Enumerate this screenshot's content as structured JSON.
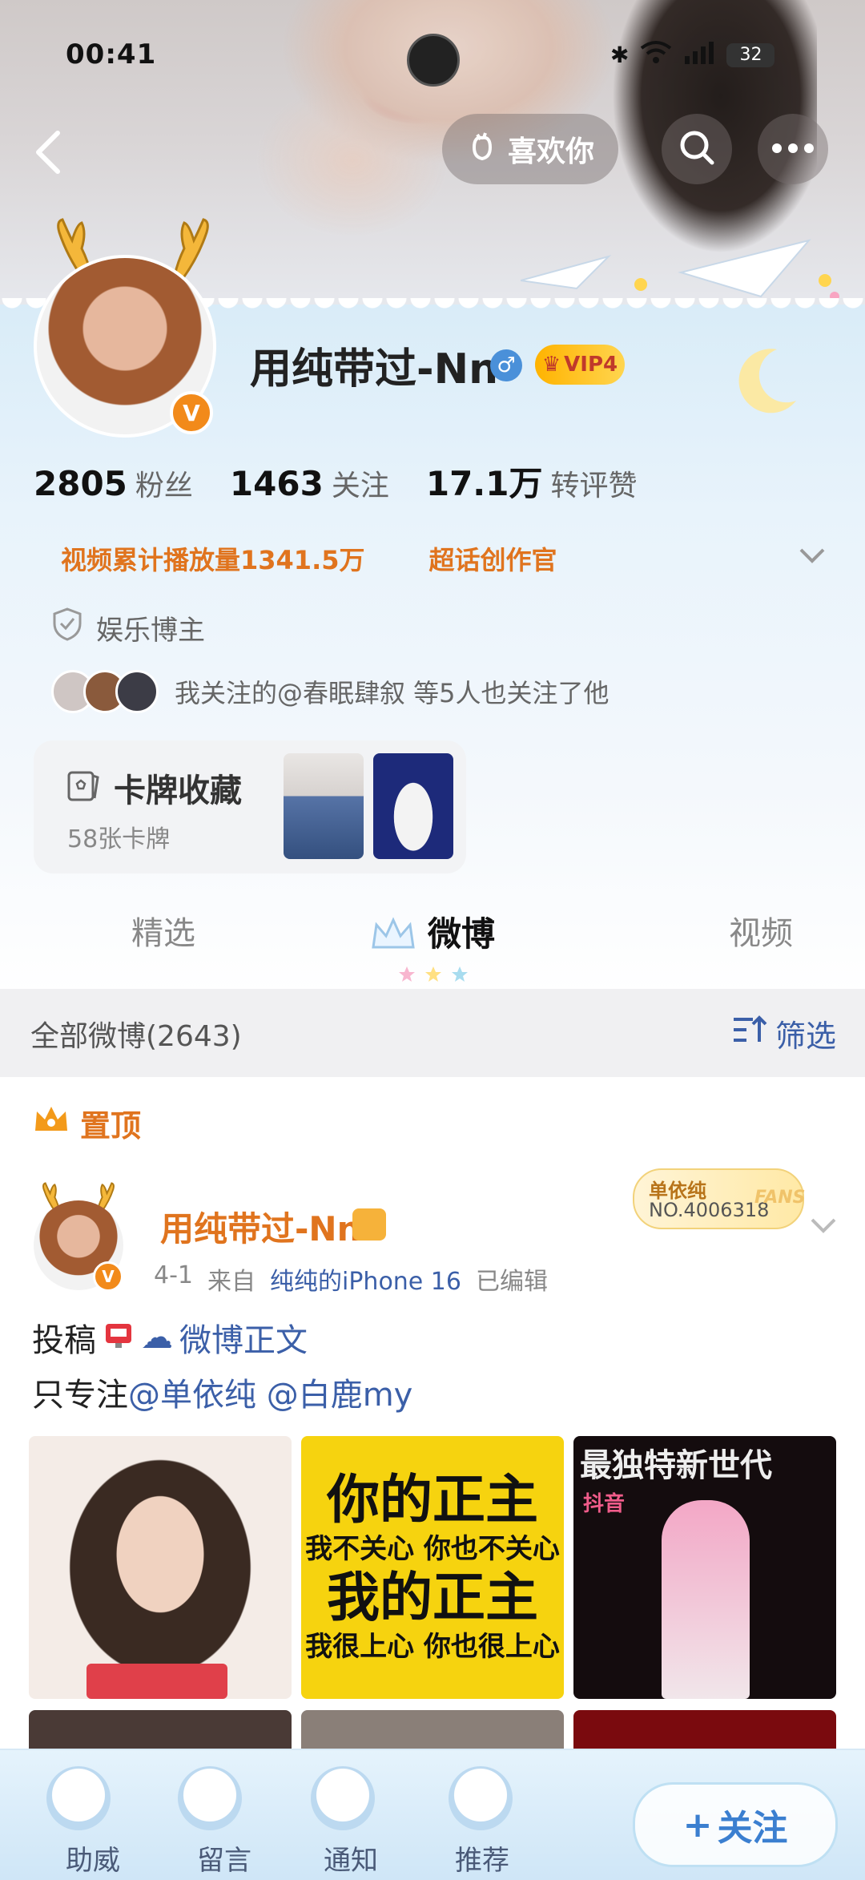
{
  "status_bar": {
    "time": "00:41",
    "battery": "32"
  },
  "header": {
    "like_label": "喜欢你"
  },
  "profile": {
    "name": "用纯带过-Nn",
    "vip_label": "VIP4",
    "stats": [
      {
        "value": "2805",
        "label": "粉丝"
      },
      {
        "value": "1463",
        "label": "关注"
      },
      {
        "value": "17.1万",
        "label": "转评赞"
      }
    ],
    "tags": [
      "视频累计播放量1341.5万",
      "超话创作官"
    ],
    "certification": "娱乐博主",
    "mutual_follow": "我关注的@春眠肆叙 等5人也关注了他",
    "card": {
      "title": "卡牌收藏",
      "count": "58张卡牌"
    }
  },
  "tabs": {
    "t1": "精选",
    "t2": "微博",
    "t3": "视频"
  },
  "filter_bar": {
    "all_weibo": "全部微博(2643)",
    "filter_label": "筛选"
  },
  "post": {
    "pinned_label": "置顶",
    "author": "用纯带过-Nn",
    "fans_badge": {
      "name": "单依纯",
      "number": "NO.4006318",
      "word": "FANS"
    },
    "date": "4-1",
    "source_prefix": "来自",
    "device": "纯纯的iPhone 16",
    "edited": "已编辑",
    "line1_prefix": "投稿",
    "line1_link": "微博正文",
    "line2_prefix": "只专注",
    "mention1": "@单依纯",
    "mention2": "@白鹿my",
    "images": {
      "img2_line1": "你的正主",
      "img2_line2": "我不关心 你也不关心",
      "img2_line3": "我的正主",
      "img2_line4": "我很上心 你也很上心",
      "img3_header": "最独特新世代",
      "img3_tag": "抖音"
    }
  },
  "bottom_nav": {
    "items": [
      "助威",
      "留言",
      "通知",
      "推荐"
    ],
    "follow_label": "关注"
  },
  "colors": {
    "accent_orange": "#e0741e",
    "link_blue": "#3b5fa8",
    "verified": "#f28a1a"
  }
}
